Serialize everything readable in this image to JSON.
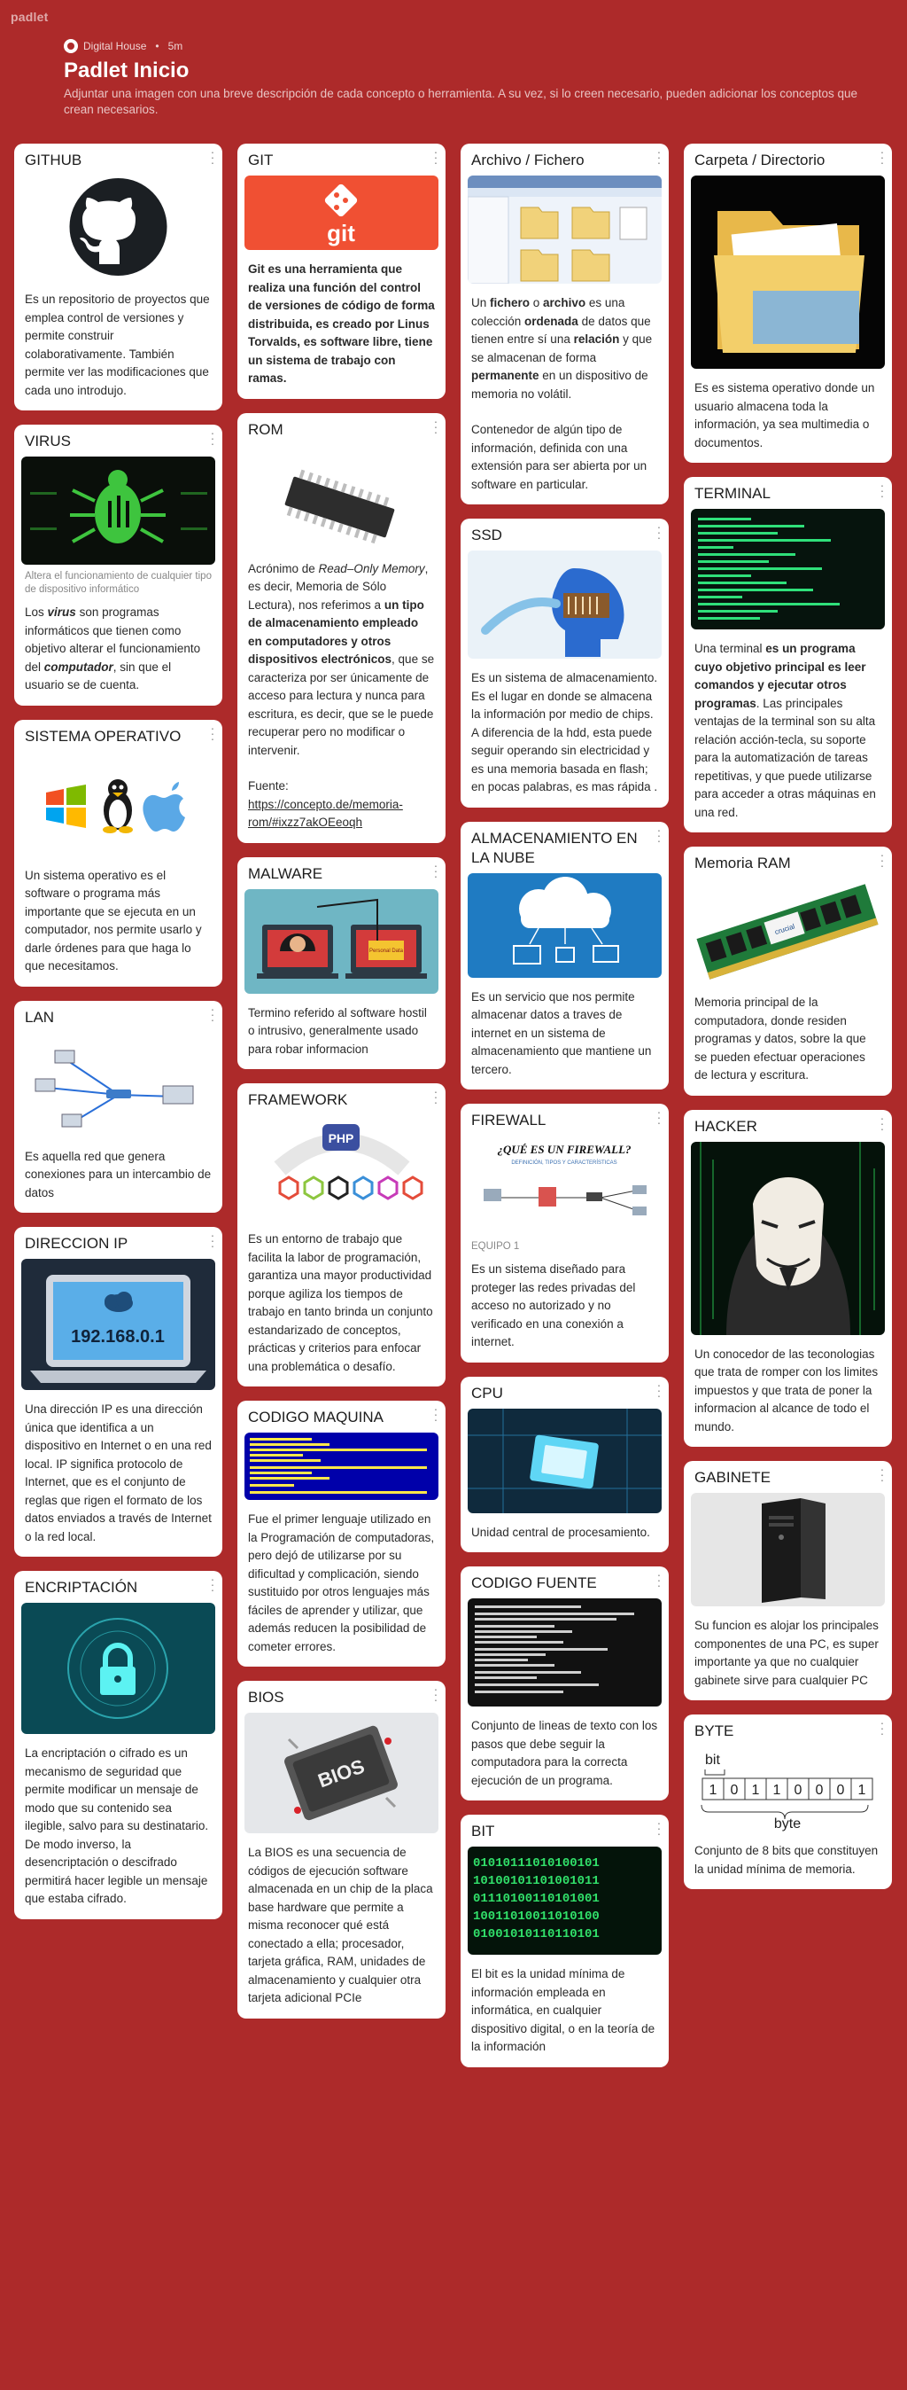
{
  "brand": "padlet",
  "header": {
    "author": "Digital House",
    "time": "5m",
    "title": "Padlet Inicio",
    "description": "Adjuntar una imagen con una breve descripción de cada concepto o herramienta. A su vez, si lo creen necesario, pueden adicionar los conceptos que crean necesarios."
  },
  "cards": {
    "github": {
      "title": "GITHUB",
      "body": "Es un repositorio de proyectos que emplea control de versiones y permite construir colaborativamente. También permite ver las modificaciones que cada uno introdujo."
    },
    "virus": {
      "title": "VIRUS",
      "caption": "Altera el funcionamiento de cualquier tipo de dispositivo informático",
      "b1": "Los ",
      "b2": "virus",
      "b3": " son programas informáticos que tienen como objetivo alterar el funcionamiento del ",
      "b4": "computador",
      "b5": ", sin que el usuario se de cuenta."
    },
    "so": {
      "title": "SISTEMA OPERATIVO",
      "body": "Un sistema operativo es el software o programa más importante que se ejecuta en un computador, nos permite usarlo y darle órdenes para que haga lo que necesitamos."
    },
    "lan": {
      "title": "LAN",
      "body": "Es aquella red que genera conexiones para un intercambio de datos"
    },
    "ip": {
      "title": "DIRECCION IP",
      "image_text": "192.168.0.1",
      "body": "Una dirección IP es una dirección única que identifica a un dispositivo en Internet o en una red local. IP significa protocolo de Internet, que es el conjunto de reglas que rigen el formato de los datos enviados a través de Internet o la red local."
    },
    "encrypt": {
      "title": "ENCRIPTACIÓN",
      "body": "La encriptación o cifrado es un mecanismo de seguridad que permite modificar un mensaje de modo que su contenido sea ilegible, salvo para su destinatario. De modo inverso, la desencriptación o descifrado permitirá hacer legible un mensaje que estaba cifrado."
    },
    "git": {
      "title": "GIT",
      "image_text": "git",
      "body": "Git es una herramienta que realiza una función del control de versiones de código de forma distribuida, es creado por Linus Torvalds, es software libre, tiene un sistema de trabajo con ramas."
    },
    "rom": {
      "title": "ROM",
      "a1": "Acrónimo de ",
      "a2": "Read–Only Memory",
      "a3": ", es decir, Memoria de Sólo Lectura), nos referimos a ",
      "a4": "un tipo de almacenamiento empleado en computadores y otros dispositivos electrónicos",
      "a5": ", que se caracteriza por ser únicamente de acceso para lectura y nunca para escritura, es decir, que se le puede recuperar pero no modificar o intervenir.",
      "source_label": "Fuente:",
      "link": "https://concepto.de/memoria-rom/#ixzz7akOEeoqh"
    },
    "malware": {
      "title": "MALWARE",
      "image_text": "Personal Data",
      "body": "Termino referido al software hostil o intrusivo, generalmente usado para robar informacion"
    },
    "framework": {
      "title": "FRAMEWORK",
      "image_text": "PHP",
      "body": "Es un entorno de trabajo que facilita la labor de programación, garantiza una mayor productividad porque agiliza los tiempos de trabajo en tanto brinda un conjunto estandarizado de conceptos, prácticas y criterios para enfocar una problemática o desafío."
    },
    "machine": {
      "title": "CODIGO MAQUINA",
      "body": "Fue el primer lenguaje utilizado en la Programación de computadoras, pero dejó de utilizarse por su dificultad y complicación, siendo sustituido por otros lenguajes más fáciles de aprender y utilizar, que además reducen la posibilidad de cometer errores."
    },
    "bios": {
      "title": "BIOS",
      "image_text": "BIOS",
      "body": "La BIOS es una secuencia de códigos de ejecución software almacenada en un chip de la placa base hardware que permite a misma reconocer qué está conectado a ella; procesador, tarjeta gráfica, RAM, unidades de almacenamiento y cualquier otra tarjeta adicional PCIe"
    },
    "archivo": {
      "title": "Archivo / Fichero",
      "p1a": "Un ",
      "p1b": "fichero",
      "p1c": " o ",
      "p1d": "archivo",
      "p1e": " es una colección ",
      "p1f": "ordenada",
      "p1g": " de datos que tienen entre sí una ",
      "p1h": "relación",
      "p1i": " y que se almacenan de forma ",
      "p1j": "permanente",
      "p1k": " en un dispositivo de memoria no volátil.",
      "p2": "Contenedor de algún tipo de información, definida con una extensión para ser abierta por un software en particular."
    },
    "ssd": {
      "title": "SSD",
      "body": "Es un sistema de almacenamiento. Es el lugar en donde se almacena la información por medio de chips. A diferencia de la hdd, esta puede seguir operando sin electricidad y es una memoria basada en flash; en pocas palabras, es mas rápida ."
    },
    "cloud": {
      "title": "ALMACENAMIENTO EN LA NUBE",
      "body": "Es un servicio que nos permite almacenar datos a traves de internet en un sistema de almacenamiento que mantiene un tercero."
    },
    "firewall": {
      "title": "FIREWALL",
      "image_title": "¿QUÉ ES UN FIREWALL?",
      "image_sub": "DEFINICIÓN, TIPOS Y CARACTERÍSTICAS",
      "caption": "EQUIPO 1",
      "body": "Es un sistema diseñado para proteger las redes privadas del acceso no autorizado y no verificado en una conexión a internet."
    },
    "cpu": {
      "title": "CPU",
      "body": "Unidad central de procesamiento."
    },
    "source": {
      "title": "CODIGO FUENTE",
      "body": "Conjunto de lineas de texto con los pasos que debe seguir la computadora para la correcta ejecución de un programa."
    },
    "bit": {
      "title": "BIT",
      "body": "El bit es la unidad mínima de información empleada en informática, en cualquier dispositivo digital, o en la teoría de la información"
    },
    "carpeta": {
      "title": "Carpeta / Directorio",
      "body": "Es es sistema operativo donde un usuario almacena toda la información, ya sea multimedia o documentos."
    },
    "terminal": {
      "title": "TERMINAL",
      "t1": "Una terminal ",
      "t2": "es un programa cuyo objetivo principal es leer comandos y ejecutar otros programas",
      "t3": ". Las principales ventajas de la terminal son su alta relación acción-tecla, su soporte para la automatización de tareas repetitivas, y que puede utilizarse para acceder a otras máquinas en una red."
    },
    "ram": {
      "title": "Memoria RAM",
      "image_text": "crucial",
      "body": "Memoria principal de la computadora, donde residen programas y datos, sobre la que se pueden efectuar operaciones de lectura y escritura."
    },
    "hacker": {
      "title": "HACKER",
      "body": "Un conocedor de las teconologias que trata de romper con los limites impuestos y que trata de poner la informacion al alcance de todo el mundo."
    },
    "gabinete": {
      "title": "GABINETE",
      "body": "Su funcion es alojar los principales componentes de una PC, es super importante ya que no cualquier gabinete sirve para cualquier PC"
    },
    "byte": {
      "title": "BYTE",
      "image_top": "bit",
      "image_bottom": "byte",
      "bits": [
        "1",
        "0",
        "1",
        "1",
        "0",
        "0",
        "0",
        "1"
      ],
      "body": "Conjunto de 8 bits que constituyen la unidad mínima de memoria."
    }
  }
}
